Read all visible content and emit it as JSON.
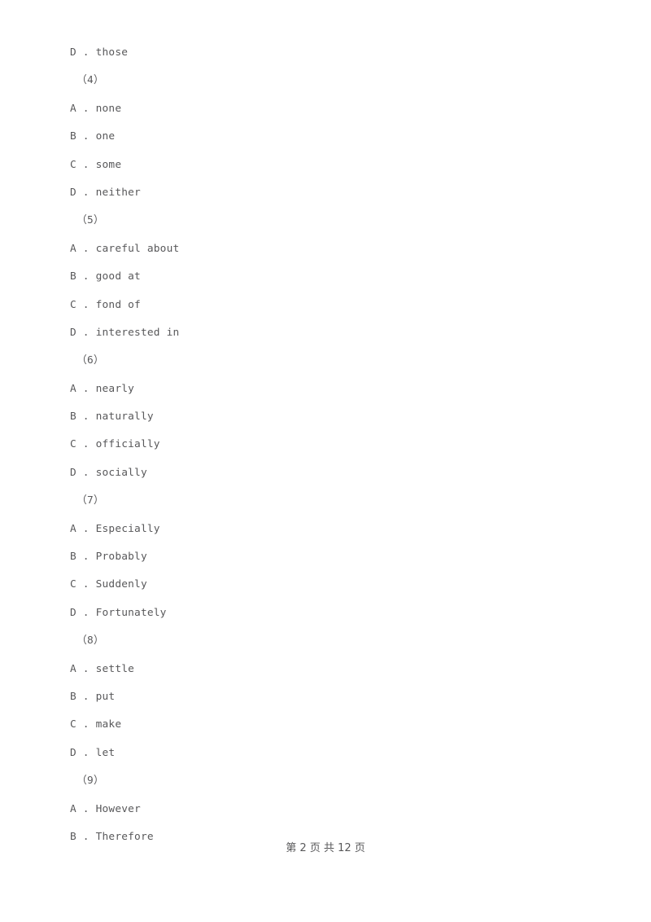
{
  "document": {
    "type": "exam-paper",
    "text_color": "#58585a",
    "background_color": "#ffffff"
  },
  "lines": [
    {
      "kind": "option",
      "letter": "D",
      "separator": " . ",
      "text": "those"
    },
    {
      "kind": "question",
      "label": "（4）"
    },
    {
      "kind": "option",
      "letter": "A",
      "separator": " . ",
      "text": "none"
    },
    {
      "kind": "option",
      "letter": "B",
      "separator": " . ",
      "text": "one"
    },
    {
      "kind": "option",
      "letter": "C",
      "separator": " . ",
      "text": "some"
    },
    {
      "kind": "option",
      "letter": "D",
      "separator": " . ",
      "text": "neither"
    },
    {
      "kind": "question",
      "label": "（5）"
    },
    {
      "kind": "option",
      "letter": "A",
      "separator": " . ",
      "text": "careful about"
    },
    {
      "kind": "option",
      "letter": "B",
      "separator": " . ",
      "text": "good at"
    },
    {
      "kind": "option",
      "letter": "C",
      "separator": " . ",
      "text": "fond of"
    },
    {
      "kind": "option",
      "letter": "D",
      "separator": " . ",
      "text": "interested in"
    },
    {
      "kind": "question",
      "label": "（6）"
    },
    {
      "kind": "option",
      "letter": "A",
      "separator": " . ",
      "text": "nearly"
    },
    {
      "kind": "option",
      "letter": "B",
      "separator": " . ",
      "text": "naturally"
    },
    {
      "kind": "option",
      "letter": "C",
      "separator": " . ",
      "text": "officially"
    },
    {
      "kind": "option",
      "letter": "D",
      "separator": " . ",
      "text": "socially"
    },
    {
      "kind": "question",
      "label": "（7）"
    },
    {
      "kind": "option",
      "letter": "A",
      "separator": " . ",
      "text": "Especially"
    },
    {
      "kind": "option",
      "letter": "B",
      "separator": " . ",
      "text": "Probably"
    },
    {
      "kind": "option",
      "letter": "C",
      "separator": " . ",
      "text": "Suddenly"
    },
    {
      "kind": "option",
      "letter": "D",
      "separator": " . ",
      "text": "Fortunately"
    },
    {
      "kind": "question",
      "label": "（8）"
    },
    {
      "kind": "option",
      "letter": "A",
      "separator": " . ",
      "text": "settle"
    },
    {
      "kind": "option",
      "letter": "B",
      "separator": " . ",
      "text": "put"
    },
    {
      "kind": "option",
      "letter": "C",
      "separator": " . ",
      "text": "make"
    },
    {
      "kind": "option",
      "letter": "D",
      "separator": " . ",
      "text": "let"
    },
    {
      "kind": "question",
      "label": "（9）"
    },
    {
      "kind": "option",
      "letter": "A",
      "separator": " . ",
      "text": "However"
    },
    {
      "kind": "option",
      "letter": "B",
      "separator": " . ",
      "text": "Therefore"
    }
  ],
  "footer": {
    "page_indicator": "第 2 页 共 12 页",
    "current_page": 2,
    "total_pages": 12
  }
}
